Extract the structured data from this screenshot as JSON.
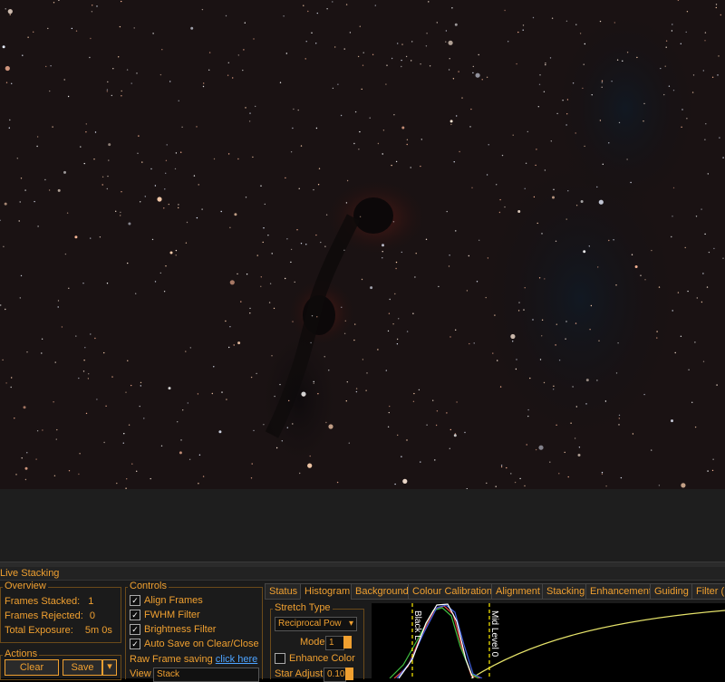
{
  "panel_title": "Live Stacking",
  "overview": {
    "legend": "Overview",
    "frames_stacked_label": "Frames Stacked:",
    "frames_stacked_value": "1",
    "frames_rejected_label": "Frames Rejected:",
    "frames_rejected_value": "0",
    "total_exposure_label": "Total Exposure:",
    "total_exposure_value": "5m 0s"
  },
  "actions": {
    "legend": "Actions",
    "clear_label": "Clear",
    "save_label": "Save"
  },
  "controls": {
    "legend": "Controls",
    "align_frames": "Align Frames",
    "fwhm_filter": "FWHM Filter",
    "brightness_filter": "Brightness Filter",
    "auto_save": "Auto Save on Clear/Close",
    "raw_frame_saving": "Raw Frame saving",
    "click_here": "click here",
    "view_label": "View",
    "view_value": "Stack"
  },
  "tabs": [
    "Status",
    "Histogram",
    "Background",
    "Colour Calibration",
    "Alignment",
    "Stacking",
    "Enhancement",
    "Guiding",
    "Filter (F"
  ],
  "active_tab": "Histogram",
  "stretch": {
    "legend": "Stretch Type",
    "type_value": "Reciprocal Pow",
    "mode_label": "Mode",
    "mode_value": "1",
    "enhance_color": "Enhance Color",
    "star_adjust_label": "Star Adjust",
    "star_adjust_value": "0.10"
  },
  "histogram": {
    "black_level_label": "Black L",
    "mid_level_label": "Mid Level 0"
  },
  "colors": {
    "accent": "#f0a030",
    "link": "#4da3ff",
    "background": "#1b1b1b"
  }
}
